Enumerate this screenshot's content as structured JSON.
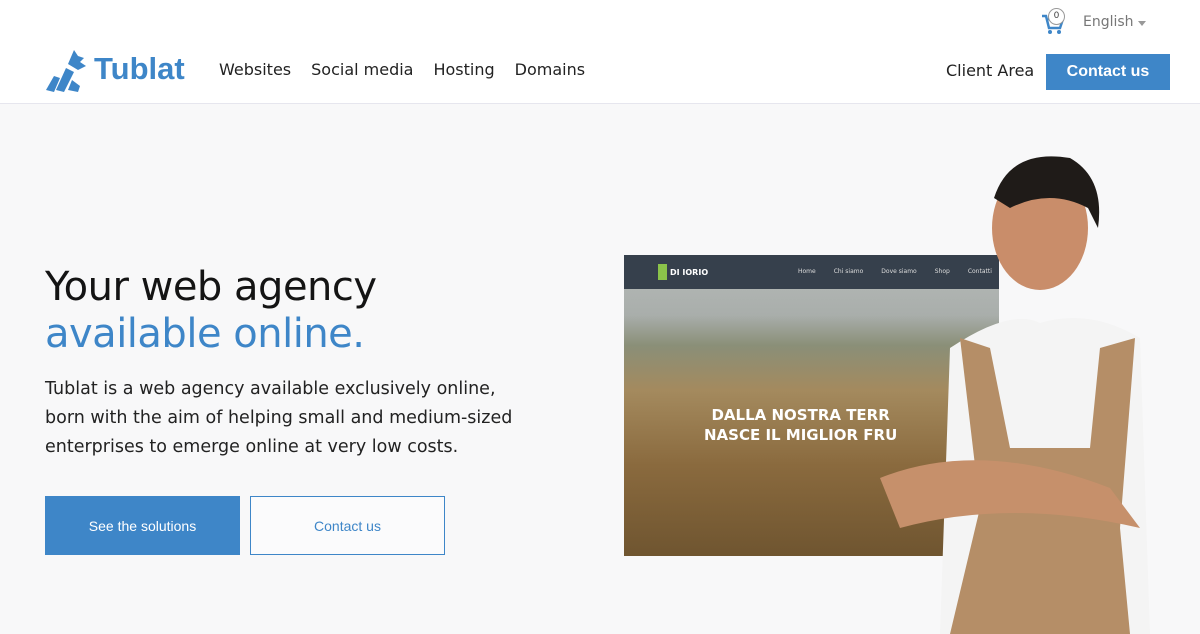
{
  "header": {
    "brand": "Tublat",
    "nav": [
      "Websites",
      "Social media",
      "Hosting",
      "Domains"
    ],
    "cart_count": "0",
    "language": "English",
    "client_area": "Client Area",
    "contact_button": "Contact us"
  },
  "hero": {
    "title_line1": "Your web agency",
    "title_line2": "available online.",
    "description": "Tublat is a web agency available exclusively online, born with the aim of helping small and medium-sized enterprises to emerge online at very low costs.",
    "primary_button": "See the solutions",
    "secondary_button": "Contact us"
  },
  "mockup": {
    "brand": "DI IORIO",
    "nav": [
      "Home",
      "Chi siamo",
      "Dove siamo",
      "Shop",
      "Contatti"
    ],
    "headline_line1": "DALLA NOSTRA TERR",
    "headline_line2": "NASCE IL MIGLIOR FRU"
  },
  "colors": {
    "accent": "#3e86c8"
  }
}
